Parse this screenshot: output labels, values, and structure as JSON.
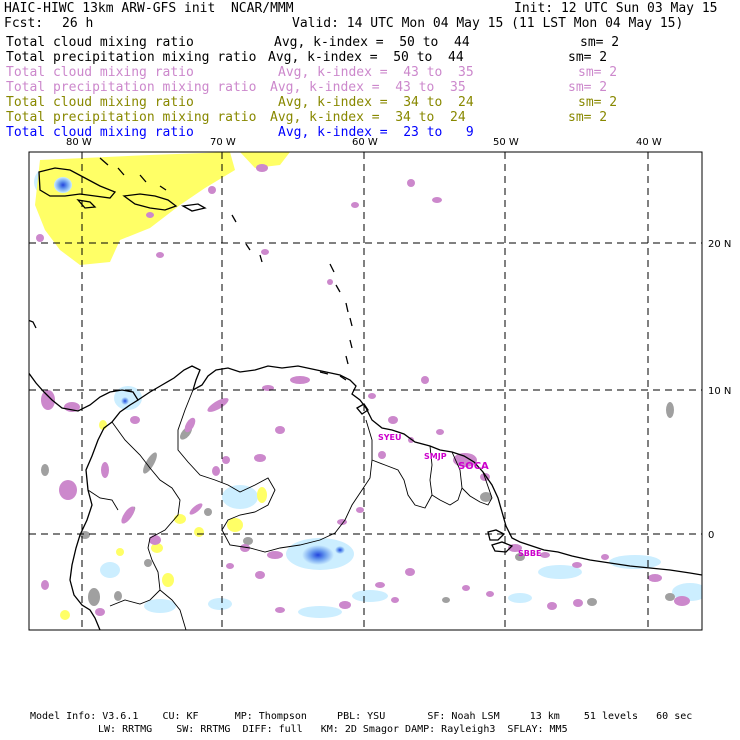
{
  "header": {
    "model_title": "HAIC-HIWC 13km ARW-GFS init  NCAR/MMM",
    "init": "Init: 12 UTC Sun 03 May 15",
    "fcst_label": "Fcst:",
    "fcst_value": "26 h",
    "valid": "Valid: 14 UTC Mon 04 May 15 (11 LST Mon 04 May 15)"
  },
  "legend": [
    {
      "field": "Total cloud mixing ratio",
      "avg": "Avg, k-index =  50 to  44",
      "sm": "sm= 2",
      "color": "#000000"
    },
    {
      "field": "Total precipitation mixing ratio",
      "avg": "Avg, k-index =  50 to  44",
      "sm": "sm= 2",
      "color": "#000000"
    },
    {
      "field": "Total cloud mixing ratio",
      "avg": "Avg, k-index =  43 to  35",
      "sm": "sm= 2",
      "color": "#cc88cc"
    },
    {
      "field": "Total precipitation mixing ratio",
      "avg": "Avg, k-index =  43 to  35",
      "sm": "sm= 2",
      "color": "#cc88cc"
    },
    {
      "field": "Total cloud mixing ratio",
      "avg": "Avg, k-index =  34 to  24",
      "sm": "sm= 2",
      "color": "#888800"
    },
    {
      "field": "Total precipitation mixing ratio",
      "avg": "Avg, k-index =  34 to  24",
      "sm": "sm= 2",
      "color": "#888800"
    },
    {
      "field": "Total cloud mixing ratio",
      "avg": "Avg, k-index =  23 to   9",
      "sm": "",
      "color": "#0000ff"
    }
  ],
  "map": {
    "lon_labels": [
      "80 W",
      "70 W",
      "60 W",
      "50 W",
      "40 W"
    ],
    "lat_labels": [
      "20 N",
      "10 N",
      "0"
    ],
    "cities": [
      "SYEU",
      "SMJP",
      "SOCA",
      "SBBE"
    ],
    "colors": {
      "coast": "#000000",
      "grid": "#000000",
      "cloud_low": "#cc88cc",
      "cloud_mid": "#a0a0a0",
      "cloud_yellow": "#ffff66",
      "cloud_lightblue": "#cceeff",
      "cloud_blue": "#3366ee",
      "city": "#cc00cc"
    }
  },
  "footer": {
    "line1": "Model Info: V3.6.1    CU: KF      MP: Thompson     PBL: YSU       SF: Noah LSM     13 km    51 levels   60 sec",
    "line2": "LW: RRTMG    SW: RRTMG  DIFF: full   KM: 2D Smagor DAMP: Rayleigh3  SFLAY: MM5"
  }
}
